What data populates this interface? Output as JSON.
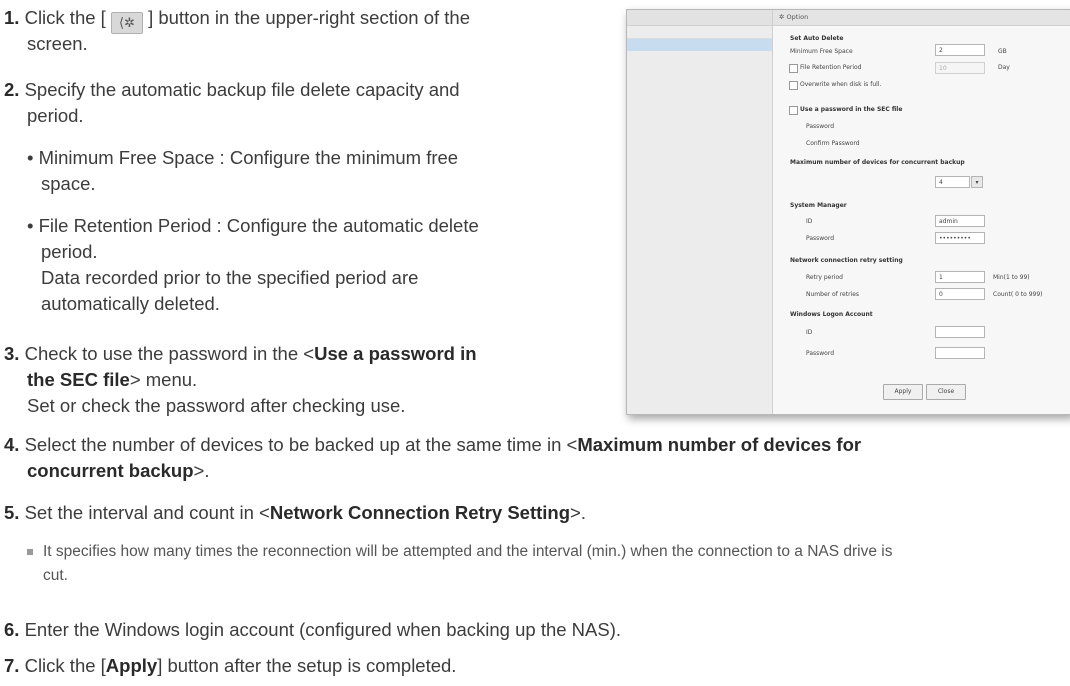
{
  "steps": {
    "s1": {
      "num": "1.",
      "pre": "Click the [",
      "post": "] button in the upper-right section of the",
      "line2": "screen.",
      "icon": "gear-icon"
    },
    "s2": {
      "num": "2.",
      "line1": "Specify the automatic backup file delete capacity and",
      "line2": "period."
    },
    "b1": {
      "line1": "• Minimum Free Space : Configure the minimum free",
      "line2": "space."
    },
    "b2": {
      "line1": "• File Retention Period : Configure the automatic delete",
      "line2": "period.",
      "line3": "Data recorded prior to the specified period are",
      "line4": "automatically deleted."
    },
    "s3": {
      "num": "3.",
      "pre": "Check to use the password in the <",
      "bold1": "Use a password in",
      "bold2": "the SEC file",
      "post": "> menu.",
      "line3": "Set or check the password after checking use."
    },
    "s4": {
      "num": "4.",
      "pre": "Select the number of devices to be backed up at the same time in <",
      "bold1": "Maximum number of devices for",
      "bold2": "concurrent backup",
      "post": ">."
    },
    "s5": {
      "num": "5.",
      "pre": "Set the interval and count in <",
      "bold": "Network Connection Retry Setting",
      "post": ">."
    },
    "note": {
      "line1": "It specifies how many times the reconnection will be attempted and the interval (min.) when the connection to a NAS drive is",
      "line2": "cut."
    },
    "s6": {
      "num": "6.",
      "text": "Enter the Windows login account (configured when backing up the NAS)."
    },
    "s7": {
      "num": "7.",
      "pre": "Click the [",
      "bold": "Apply",
      "post": "] button after the setup is completed."
    }
  },
  "dialog": {
    "title": "Option",
    "auto_delete": {
      "heading": "Set Auto Delete",
      "min_free_label": "Minimum Free Space",
      "min_free_value": "2",
      "min_free_unit": "GB",
      "retention_label": "File Retention Period",
      "retention_value": "10",
      "retention_unit": "Day",
      "overwrite_label": "Overwrite when disk is full."
    },
    "sec": {
      "heading": "Use a password in the SEC file",
      "password_label": "Password",
      "confirm_label": "Confirm Password"
    },
    "concurrent": {
      "heading": "Maximum number of devices for concurrent backup",
      "value": "4"
    },
    "system_manager": {
      "heading": "System Manager",
      "id_label": "ID",
      "id_value": "admin",
      "password_label": "Password",
      "password_value": "•••••••••"
    },
    "retry": {
      "heading": "Network connection retry setting",
      "period_label": "Retry period",
      "period_value": "1",
      "period_unit": "Min(1 to 99)",
      "count_label": "Number of retries",
      "count_value": "0",
      "count_unit": "Count( 0 to 999)"
    },
    "windows": {
      "heading": "Windows Logon Account",
      "id_label": "ID",
      "password_label": "Password"
    },
    "apply_label": "Apply",
    "close_label": "Close"
  }
}
